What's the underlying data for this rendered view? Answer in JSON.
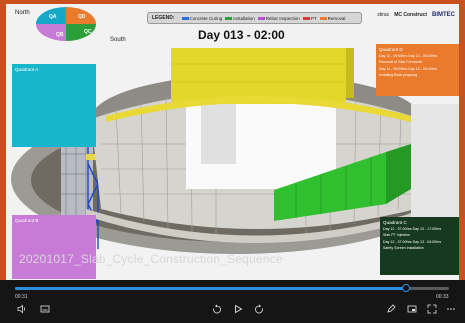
{
  "compass": {
    "north": "North",
    "south": "South",
    "quadrants": [
      "QA",
      "QD",
      "QB",
      "QC"
    ]
  },
  "legend": {
    "title": "LEGEND:",
    "items": [
      {
        "label": "Concrete Curing",
        "color": "#2b6be3"
      },
      {
        "label": "Installation",
        "color": "#2e9e3a"
      },
      {
        "label": "Rebar Inspection",
        "color": "#b64fd0"
      },
      {
        "label": "PT",
        "color": "#d93a3a"
      },
      {
        "label": "Removal",
        "color": "#ea7a2c"
      }
    ]
  },
  "day_label": "Day 013 - 02:00",
  "brand": [
    "stirac",
    "MC Construct",
    "BIMTEC"
  ],
  "panels": {
    "qa": {
      "title": "Quadrant A"
    },
    "qb": {
      "title": "Quadrant B"
    },
    "qd": {
      "title": "Quadrant D",
      "lines": [
        "Day 11 - 09:00hrs   Day 13 - 05:00hrs",
        "Removal of Slab Formwork",
        "Day 11 - 09:00hrs   Day 13 - 05:00hrs",
        "Installing Back propping"
      ]
    },
    "qc": {
      "title": "Quadrant C",
      "lines": [
        "Day 12 - 07:00hrs   Day 13 - 17:00hrs",
        "Slab PT Injection",
        "Day 12 - 07:00hrs   Day 13 - 04:00hrs",
        "Safety Screen Installation"
      ]
    }
  },
  "caption": "20201017_Slab_Cycle_Construction_Sequence",
  "player": {
    "time_current": "00:31",
    "time_total": "00:33",
    "progress": 0.9,
    "icons": [
      "volume-icon",
      "subtitles-icon",
      "rewind-icon",
      "play-icon",
      "forward-icon",
      "edit-icon",
      "miniplayer-icon",
      "fullscreen-icon",
      "more-icon"
    ]
  }
}
